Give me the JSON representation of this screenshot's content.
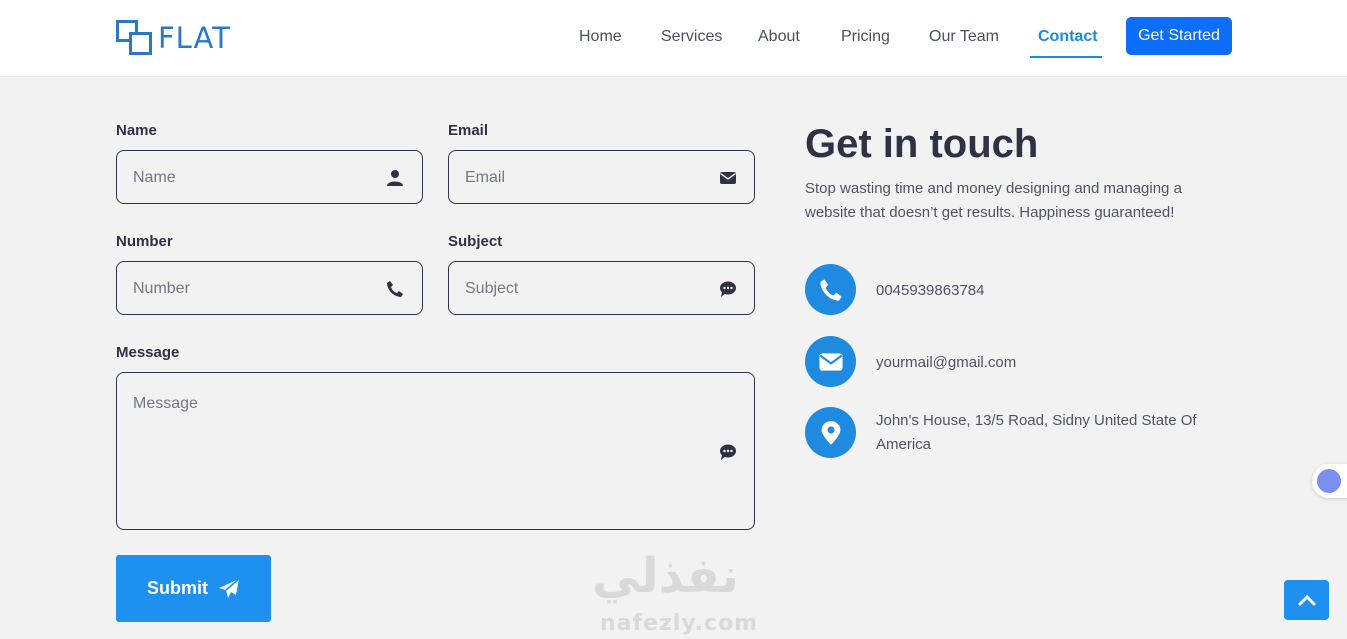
{
  "brand": {
    "name": "FLAT"
  },
  "nav": {
    "items": [
      "Home",
      "Services",
      "About",
      "Pricing",
      "Our Team",
      "Contact"
    ],
    "active": "Contact",
    "cta": "Get Started"
  },
  "form": {
    "name": {
      "label": "Name",
      "placeholder": "Name",
      "icon": "user-icon"
    },
    "email": {
      "label": "Email",
      "placeholder": "Email",
      "icon": "envelope-icon"
    },
    "number": {
      "label": "Number",
      "placeholder": "Number",
      "icon": "phone-icon"
    },
    "subject": {
      "label": "Subject",
      "placeholder": "Subject",
      "icon": "comment-icon"
    },
    "message": {
      "label": "Message",
      "placeholder": "Message",
      "icon": "comment-icon"
    },
    "submit": "Submit"
  },
  "contact": {
    "title": "Get in touch",
    "intro": "Stop wasting time and money designing and managing a website that doesn’t get results. Happiness guaranteed!",
    "phone": "0045939863784",
    "email": "yourmail@gmail.com",
    "address": "John's House, 13/5 Road, Sidny United State Of America"
  },
  "watermark": {
    "arabic": "نفذلي",
    "latin": "nafezly.com"
  },
  "colors": {
    "accent": "#1e8ae0",
    "cta": "#0d6efd",
    "brand": "#2a78c8",
    "background": "#f2f2f3"
  }
}
